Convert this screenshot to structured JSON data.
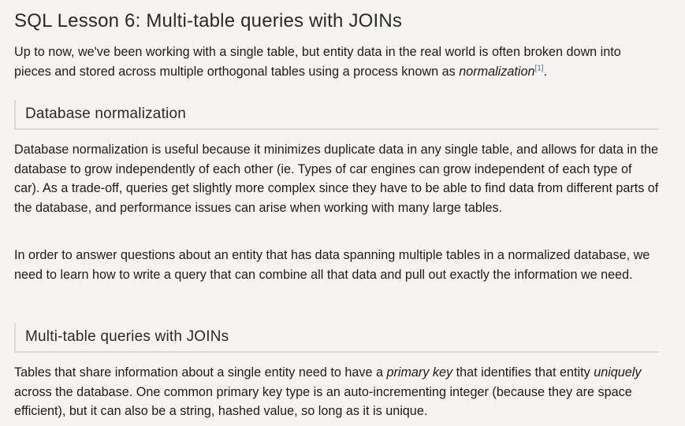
{
  "title": "SQL Lesson 6: Multi-table queries with JOINs",
  "intro": {
    "text_before": "Up to now, we've been working with a single table, but entity data in the real world is often broken down into pieces and stored across multiple orthogonal tables using a process known as ",
    "term": "normalization",
    "footnote": "[1]",
    "text_after": "."
  },
  "sections": [
    {
      "heading": "Database normalization",
      "paragraphs": [
        "Database normalization is useful because it minimizes duplicate data in any single table, and allows for data in the database to grow independently of each other (ie. Types of car engines can grow independent of each type of car). As a trade-off, queries get slightly more complex since they have to be able to find data from different parts of the database, and performance issues can arise when working with many large tables.",
        "In order to answer questions about an entity that has data spanning multiple tables in a normalized database, we need to learn how to write a query that can combine all that data and pull out exactly the information we need."
      ]
    },
    {
      "heading": "Multi-table queries with JOINs",
      "paragraph": {
        "text1": "Tables that share information about a single entity need to have a ",
        "term1": "primary key",
        "text2": " that identifies that entity ",
        "term2": "uniquely",
        "text3": " across the database. One common primary key type is an auto-incrementing integer (because they are space efficient), but it can also be a string, hashed value, so long as it is unique."
      }
    }
  ]
}
